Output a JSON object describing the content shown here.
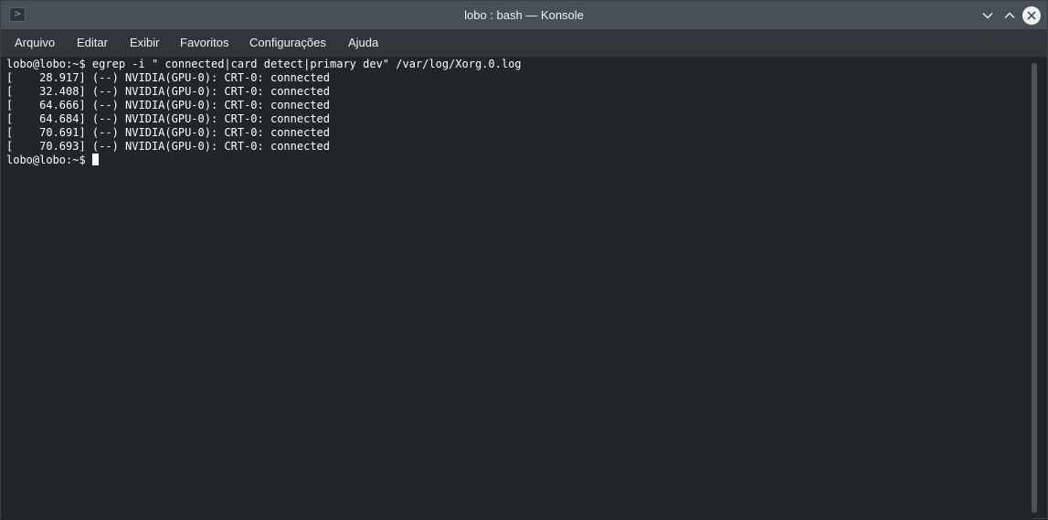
{
  "window": {
    "title": "lobo : bash — Konsole",
    "icon": "terminal-app-icon"
  },
  "titlebar": {
    "minimize_icon": "chevron-down-icon",
    "maximize_icon": "chevron-up-icon",
    "close_icon": "close-icon"
  },
  "menu": {
    "items": [
      {
        "label": "Arquivo"
      },
      {
        "label": "Editar"
      },
      {
        "label": "Exibir"
      },
      {
        "label": "Favoritos"
      },
      {
        "label": "Configurações"
      },
      {
        "label": "Ajuda"
      }
    ]
  },
  "terminal": {
    "lines": [
      "lobo@lobo:~$ egrep -i \" connected|card detect|primary dev\" /var/log/Xorg.0.log",
      "[    28.917] (--) NVIDIA(GPU-0): CRT-0: connected",
      "[    32.408] (--) NVIDIA(GPU-0): CRT-0: connected",
      "[    64.666] (--) NVIDIA(GPU-0): CRT-0: connected",
      "[    64.684] (--) NVIDIA(GPU-0): CRT-0: connected",
      "[    70.691] (--) NVIDIA(GPU-0): CRT-0: connected",
      "[    70.693] (--) NVIDIA(GPU-0): CRT-0: connected"
    ],
    "prompt": "lobo@lobo:~$"
  },
  "colors": {
    "titlebar": "#475057",
    "menubar": "#31363b",
    "terminal_bg": "#232629",
    "terminal_fg": "#fcfcfc"
  }
}
